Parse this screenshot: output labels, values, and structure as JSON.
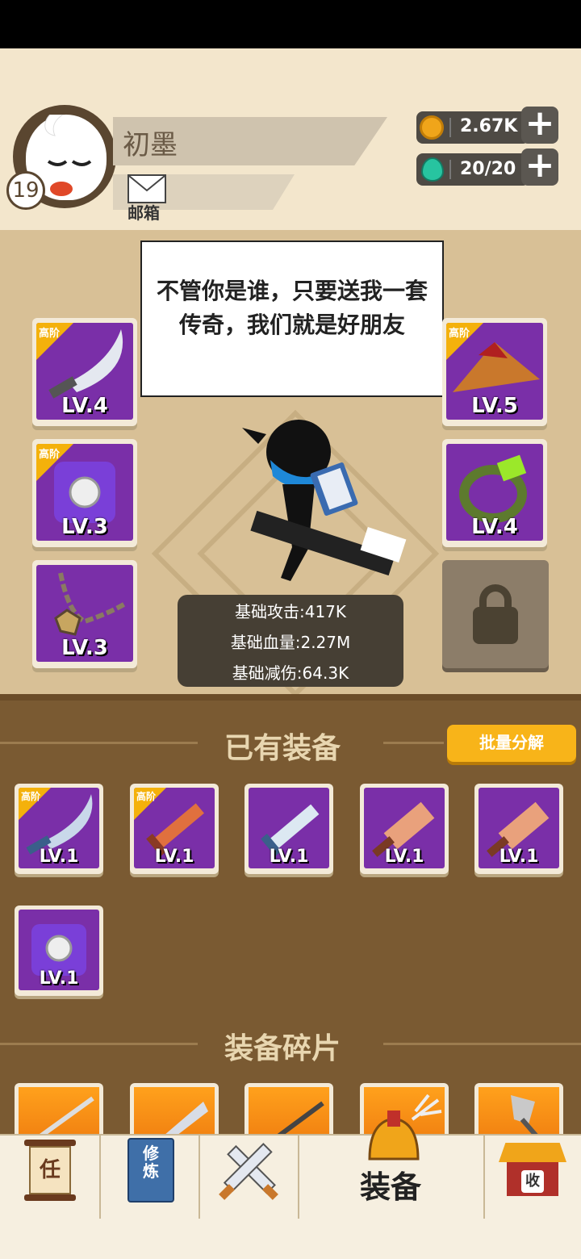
{
  "player": {
    "name": "初墨",
    "level": "19",
    "mail_label": "邮箱"
  },
  "resources": {
    "coins": "2.67K",
    "energy": "20/20",
    "plus_symbol": "+"
  },
  "speech": "不管你是谁，只要送我一套传奇，我们就是好朋友",
  "slots": {
    "weapon": {
      "tag": "高阶",
      "level": "LV.4"
    },
    "armor": {
      "tag": "高阶",
      "level": "LV.3"
    },
    "necklace": {
      "level": "LV.3"
    },
    "hat": {
      "tag": "高阶",
      "level": "LV.5"
    },
    "bracelet": {
      "level": "LV.4"
    }
  },
  "stats": {
    "attack": "基础攻击:417K",
    "hp": "基础血量:2.27M",
    "defense": "基础减伤:64.3K"
  },
  "owned": {
    "title": "已有装备",
    "batch_button": "批量分解",
    "items": [
      {
        "tag": "高阶",
        "level": "LV.1"
      },
      {
        "tag": "高阶",
        "level": "LV.1"
      },
      {
        "tag": "",
        "level": "LV.1"
      },
      {
        "tag": "",
        "level": "LV.1"
      },
      {
        "tag": "",
        "level": "LV.1"
      },
      {
        "tag": "",
        "level": "LV.1"
      }
    ]
  },
  "fragments": {
    "title": "装备碎片"
  },
  "nav": {
    "tasks_icon_char": "任",
    "cultivate_icon_text": "修炼",
    "equip_label": "装备",
    "collect_icon_char": "收"
  },
  "colors": {
    "purple": "#7a2fa8",
    "gold": "#f8b419",
    "brown": "#7a5a32",
    "orange": "#f07e10"
  }
}
